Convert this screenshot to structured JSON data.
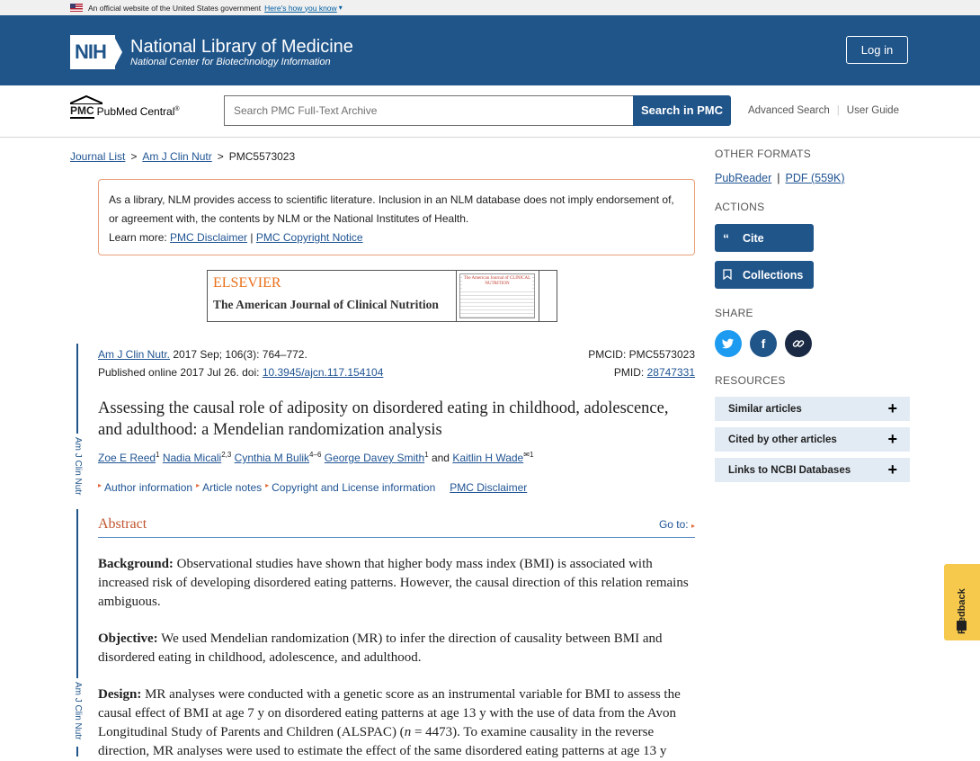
{
  "gov_banner": {
    "text": "An official website of the United States government",
    "link": "Here's how you know"
  },
  "header": {
    "logo_mark": "NIH",
    "title": "National Library of Medicine",
    "subtitle": "National Center for Biotechnology Information",
    "login": "Log in"
  },
  "search": {
    "logo_mark": "PMC",
    "logo_name": "PubMed Central",
    "logo_reg": "®",
    "placeholder": "Search PMC Full-Text Archive",
    "button": "Search in PMC",
    "advanced": "Advanced Search",
    "guide": "User Guide"
  },
  "breadcrumb": {
    "journal_list": "Journal List",
    "journal": "Am J Clin Nutr",
    "current": "PMC5573023"
  },
  "notice": {
    "text": "As a library, NLM provides access to scientific literature. Inclusion in an NLM database does not imply endorsement of, or agreement with, the contents by NLM or the National Institutes of Health.",
    "learn_more": "Learn more:",
    "disclaimer": "PMC Disclaimer",
    "sep": "|",
    "copyright": "PMC Copyright Notice"
  },
  "journal_banner": {
    "publisher": "ELSEVIER",
    "journal": "The American Journal of Clinical Nutrition",
    "cover_title": "The American Journal of CLINICAL NUTRITION"
  },
  "side_label": "Am J Clin Nutr",
  "citation": {
    "journal_link": "Am J Clin Nutr.",
    "details": "2017 Sep; 106(3): 764–772.",
    "published": "Published online 2017 Jul 26. doi:",
    "doi": "10.3945/ajcn.117.154104",
    "pmcid": "PMCID: PMC5573023",
    "pmid_label": "PMID:",
    "pmid": "28747331"
  },
  "article": {
    "title": "Assessing the causal role of adiposity on disordered eating in childhood, adolescence, and adulthood: a Mendelian randomization analysis",
    "authors": [
      {
        "name": "Zoe E Reed",
        "sup": "1"
      },
      {
        "name": "Nadia Micali",
        "sup": "2,3"
      },
      {
        "name": "Cynthia M Bulik",
        "sup": "4–6"
      },
      {
        "name": "George Davey Smith",
        "sup": "1"
      },
      {
        "name": "Kaitlin H Wade",
        "sup": "1"
      }
    ],
    "and": "and",
    "links": [
      "Author information",
      "Article notes",
      "Copyright and License information"
    ],
    "disclaimer": "PMC Disclaimer"
  },
  "abstract": {
    "heading": "Abstract",
    "goto": "Go to:",
    "background_label": "Background:",
    "background": "Observational studies have shown that higher body mass index (BMI) is associated with increased risk of developing disordered eating patterns. However, the causal direction of this relation remains ambiguous.",
    "objective_label": "Objective:",
    "objective": "We used Mendelian randomization (MR) to infer the direction of causality between BMI and disordered eating in childhood, adolescence, and adulthood.",
    "design_label": "Design:",
    "design_a": "MR analyses were conducted with a genetic score as an instrumental variable for BMI to assess the causal effect of BMI at age 7 y on disordered eating patterns at age 13 y with the use of data from the Avon Longitudinal Study of Parents and Children (ALSPAC) (",
    "design_n": "n",
    "design_b": " = 4473). To examine causality in the reverse direction, MR analyses were used to estimate the effect of the same disordered eating patterns at age 13 y"
  },
  "sidebar": {
    "other_formats": "OTHER FORMATS",
    "pubreader": "PubReader",
    "bar": "|",
    "pdf": "PDF (559K)",
    "actions": "ACTIONS",
    "cite": "Cite",
    "collections": "Collections",
    "share": "SHARE",
    "resources": "RESOURCES",
    "resource_items": [
      "Similar articles",
      "Cited by other articles",
      "Links to NCBI Databases"
    ]
  },
  "feedback": "Feedback",
  "colors": {
    "brand": "#20558a",
    "link": "#205493",
    "twitter": "#1d9bf0",
    "facebook": "#20558a",
    "link_share": "#1a2a44",
    "feedback": "#f6c94c"
  }
}
